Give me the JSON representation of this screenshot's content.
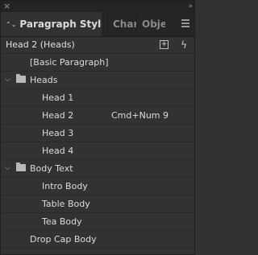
{
  "panel": {
    "close_glyph": "×",
    "collapse_glyph": "»",
    "tabs": [
      {
        "label": "Paragraph Styles"
      },
      {
        "label": "Char"
      },
      {
        "label": "Obje"
      }
    ]
  },
  "header": {
    "current_style": "Head 2 (Heads)"
  },
  "styles": {
    "basic": "[Basic Paragraph]",
    "heads_group": "Heads",
    "head1": "Head 1",
    "head2": "Head 2",
    "head2_shortcut": "Cmd+Num 9",
    "head3": "Head 3",
    "head4": "Head 4",
    "body_group": "Body Text",
    "intro_body": "Intro Body",
    "table_body": "Table Body",
    "tea_body": "Tea Body",
    "drop_cap_body": "Drop Cap Body"
  },
  "icons": {
    "active_tab_indicator": "updown-arrows-icon",
    "group_toggle": "chevron-down-icon",
    "group": "folder-icon",
    "new_style": "new-style-icon",
    "quick_apply": "lightning-icon",
    "panel_menu": "hamburger-menu-icon"
  }
}
